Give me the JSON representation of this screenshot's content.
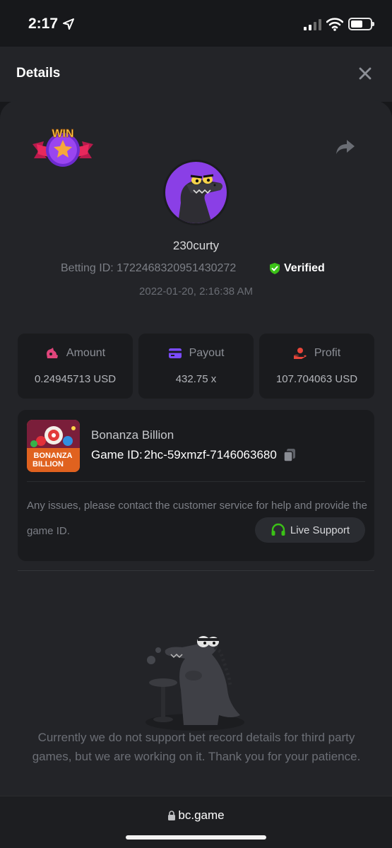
{
  "status_bar": {
    "time": "2:17"
  },
  "header": {
    "title": "Details"
  },
  "bet": {
    "badge": "WIN",
    "username": "230curty",
    "betting_id_label": "Betting ID:",
    "betting_id": "1722468320951430272",
    "verified_label": "Verified",
    "date": "2022-01-20, 2:16:38 AM"
  },
  "stats": [
    {
      "label": "Amount",
      "value": "0.24945713 USD"
    },
    {
      "label": "Payout",
      "value": "432.75 x"
    },
    {
      "label": "Profit",
      "value": "107.704063 USD"
    }
  ],
  "game": {
    "name": "Bonanza Billion",
    "id_label": "Game ID:",
    "id": "2hc-59xmzf-7146063680",
    "thumb_line1": "BONANZA",
    "thumb_line2": "BILLION"
  },
  "support": {
    "issue_text": "Any issues, please contact the customer service for help and provide the game ID.",
    "button_label": "Live Support"
  },
  "notice": "Currently we do not support bet record details for third party games, but we are working on it. Thank you for your patience.",
  "browser": {
    "url": "bc.game"
  },
  "colors": {
    "background": "#17181b",
    "panel": "#232428",
    "card": "#1a1b1e",
    "verified_green": "#3bc117",
    "payout_purple": "#7b4bff",
    "amount_pink": "#e0457b",
    "profit_red": "#e8463a"
  }
}
